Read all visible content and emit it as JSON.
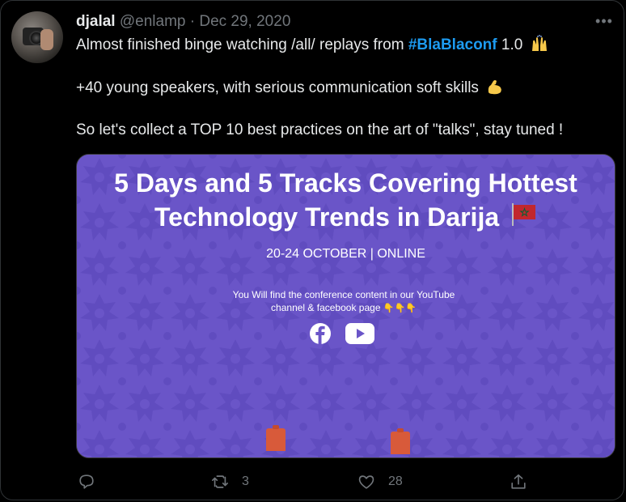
{
  "tweet": {
    "display_name": "djalal",
    "handle": "@enlamp",
    "separator": "·",
    "date": "Dec 29, 2020",
    "more_label": "•••",
    "line1_prefix": "Almost finished binge watching /all/ replays from ",
    "hashtag": "#BlaBlaconf",
    "line1_suffix": " 1.0",
    "line2": "+40 young speakers, with serious communication soft skills",
    "line3": "So let's collect a TOP 10 best practices on the art of \"talks\", stay tuned !"
  },
  "media": {
    "headline_line1": "5 Days and 5 Tracks Covering Hottest",
    "headline_line2": "Technology Trends in Darija",
    "dates": "20-24 OCTOBER | ONLINE",
    "blurb_line1": "You Will find the conference content in our YouTube",
    "blurb_line2": "channel & facebook page",
    "blurb_emoji": "👇👇👇",
    "colors": {
      "background": "#6a55c8",
      "pattern": "#5e49ba"
    }
  },
  "actions": {
    "reply_icon": "reply-icon",
    "retweet_icon": "retweet-icon",
    "retweet_count": "3",
    "like_icon": "heart-icon",
    "like_count": "28",
    "share_icon": "share-icon"
  },
  "colors": {
    "hashtag": "#1d9bf0",
    "text": "#e7e9ea",
    "muted": "#71767b"
  }
}
